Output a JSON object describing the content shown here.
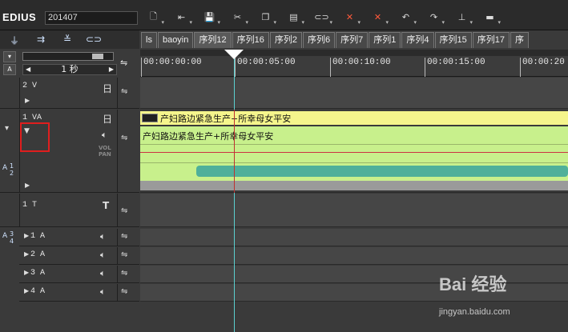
{
  "app": {
    "brand": "EDIUS",
    "project": "201407"
  },
  "toolbar": {
    "buttons": [
      {
        "name": "new-sequence-button",
        "icon": "document-icon",
        "glyph": "🗋"
      },
      {
        "name": "import-button",
        "icon": "import-icon",
        "glyph": "⇤"
      },
      {
        "name": "save-button",
        "icon": "floppy-icon",
        "glyph": "💾"
      },
      {
        "name": "cut-button",
        "icon": "scissors-icon",
        "glyph": "✂"
      },
      {
        "name": "copy-button",
        "icon": "copy-icon",
        "glyph": "❐"
      },
      {
        "name": "paste-button",
        "icon": "paste-icon",
        "glyph": "▤"
      },
      {
        "name": "link-button",
        "icon": "link-icon",
        "glyph": "⊂⊃"
      },
      {
        "name": "delete-ripple-button",
        "icon": "delete-x-icon",
        "glyph": "✕"
      },
      {
        "name": "delete-button",
        "icon": "delete-x2-icon",
        "glyph": "✕"
      },
      {
        "name": "undo-button",
        "icon": "undo-icon",
        "glyph": "↶"
      },
      {
        "name": "redo-button",
        "icon": "redo-icon",
        "glyph": "↷"
      },
      {
        "name": "audio-mix-button",
        "icon": "mixer-icon",
        "glyph": "⊥"
      },
      {
        "name": "more-button",
        "icon": "more-icon",
        "glyph": "▬"
      }
    ]
  },
  "tabs": [
    "ls",
    "baoyin",
    "序列12",
    "序列16",
    "序列2",
    "序列6",
    "序列7",
    "序列1",
    "序列4",
    "序列15",
    "序列17",
    "序"
  ],
  "zoom": {
    "unit": "1 秒"
  },
  "ruler": {
    "labels": [
      "00:00:00:00",
      "00:00:05:00",
      "00:00:10:00",
      "00:00:15:00",
      "00:00:20"
    ]
  },
  "tracks": {
    "v2": {
      "name": "2 V",
      "mode_glyph": "日"
    },
    "va1": {
      "name": "1 VA",
      "mode_glyph": "日",
      "vol_label": "VOL",
      "pan_label": "PAN",
      "side_label_top": "A",
      "side_label_n1": "1",
      "side_label_n2": "2"
    },
    "t1": {
      "name": "1 T",
      "mode_glyph": "T"
    },
    "audio_group": {
      "side_top": "A",
      "side_n1": "3",
      "side_n2": "4"
    },
    "a_tracks": [
      {
        "name": "1 A"
      },
      {
        "name": "2 A"
      },
      {
        "name": "3 A"
      },
      {
        "name": "4 A"
      }
    ]
  },
  "clips": {
    "video_title": "产妇路边紧急生产+所幸母女平安",
    "audio_title": "产妇路边紧急生产+所幸母女平安"
  },
  "watermark": {
    "brand": "Bai 经验",
    "url": "jingyan.baidu.com"
  },
  "colors": {
    "clip_yellow": "#f5f58c",
    "clip_green": "#c8f08c",
    "wave": "#4fb09a",
    "cursor": "#5bd0d0",
    "highlight": "#e01e1e"
  }
}
